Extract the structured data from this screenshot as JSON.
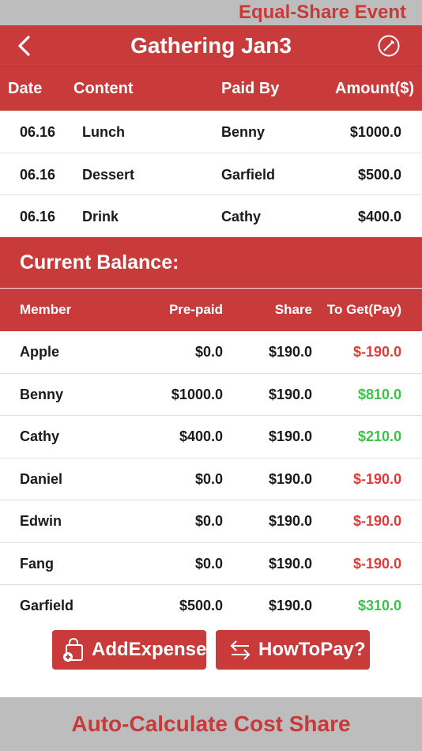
{
  "banner_top": "Equal-Share Event",
  "nav": {
    "title": "Gathering Jan3"
  },
  "expense_header": {
    "date": "Date",
    "content": "Content",
    "paid_by": "Paid By",
    "amount": "Amount($)"
  },
  "expenses": [
    {
      "date": "06.16",
      "content": "Lunch",
      "paid_by": "Benny",
      "amount": "$1000.0"
    },
    {
      "date": "06.16",
      "content": "Dessert",
      "paid_by": "Garfield",
      "amount": "$500.0"
    },
    {
      "date": "06.16",
      "content": "Drink",
      "paid_by": "Cathy",
      "amount": "$400.0"
    }
  ],
  "balance_title": "Current Balance:",
  "balance_header": {
    "member": "Member",
    "prepaid": "Pre-paid",
    "share": "Share",
    "to_get": "To Get(Pay)"
  },
  "balances": [
    {
      "member": "Apple",
      "prepaid": "$0.0",
      "share": "$190.0",
      "to_get": "$-190.0",
      "status": "neg"
    },
    {
      "member": "Benny",
      "prepaid": "$1000.0",
      "share": "$190.0",
      "to_get": "$810.0",
      "status": "pos"
    },
    {
      "member": "Cathy",
      "prepaid": "$400.0",
      "share": "$190.0",
      "to_get": "$210.0",
      "status": "pos"
    },
    {
      "member": "Daniel",
      "prepaid": "$0.0",
      "share": "$190.0",
      "to_get": "$-190.0",
      "status": "neg"
    },
    {
      "member": "Edwin",
      "prepaid": "$0.0",
      "share": "$190.0",
      "to_get": "$-190.0",
      "status": "neg"
    },
    {
      "member": "Fang",
      "prepaid": "$0.0",
      "share": "$190.0",
      "to_get": "$-190.0",
      "status": "neg"
    },
    {
      "member": "Garfield",
      "prepaid": "$500.0",
      "share": "$190.0",
      "to_get": "$310.0",
      "status": "pos"
    }
  ],
  "buttons": {
    "add_expense": "AddExpense",
    "how_to_pay": "HowToPay?"
  },
  "banner_bottom": "Auto-Calculate Cost Share",
  "icons": {
    "back": "back-arrow-icon",
    "edit": "edit-pencil-icon",
    "add_expense": "bag-plus-icon",
    "how_to_pay": "swap-arrows-icon"
  },
  "colors": {
    "primary_red": "#c93b3b",
    "banner_gray": "#bdbdbd",
    "banner_text": "#c73a3a",
    "negative": "#e03a3a",
    "positive": "#3cc14a"
  }
}
